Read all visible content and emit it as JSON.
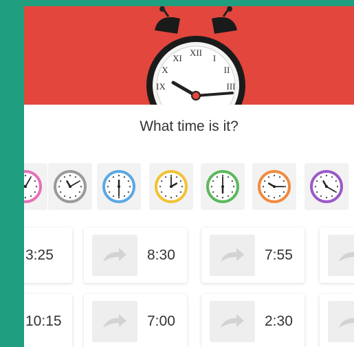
{
  "question": "What time is it?",
  "clocks": [
    {
      "ring": "#e86fb9"
    },
    {
      "ring": "#9a9a9a"
    },
    {
      "ring": "#5ba8e3"
    },
    {
      "ring": "#f1c232"
    },
    {
      "ring": "#5cb85c"
    },
    {
      "ring": "#f08a3e"
    },
    {
      "ring": "#9b59c6"
    }
  ],
  "answer_rows": [
    {
      "times": [
        "3:25",
        "8:30",
        "7:55"
      ]
    },
    {
      "times": [
        "10:15",
        "7:00",
        "2:30"
      ]
    }
  ],
  "colors": {
    "background": "#1f9e80",
    "header": "#e2463d",
    "card": "#ffffff",
    "slot": "#eeeeee"
  }
}
